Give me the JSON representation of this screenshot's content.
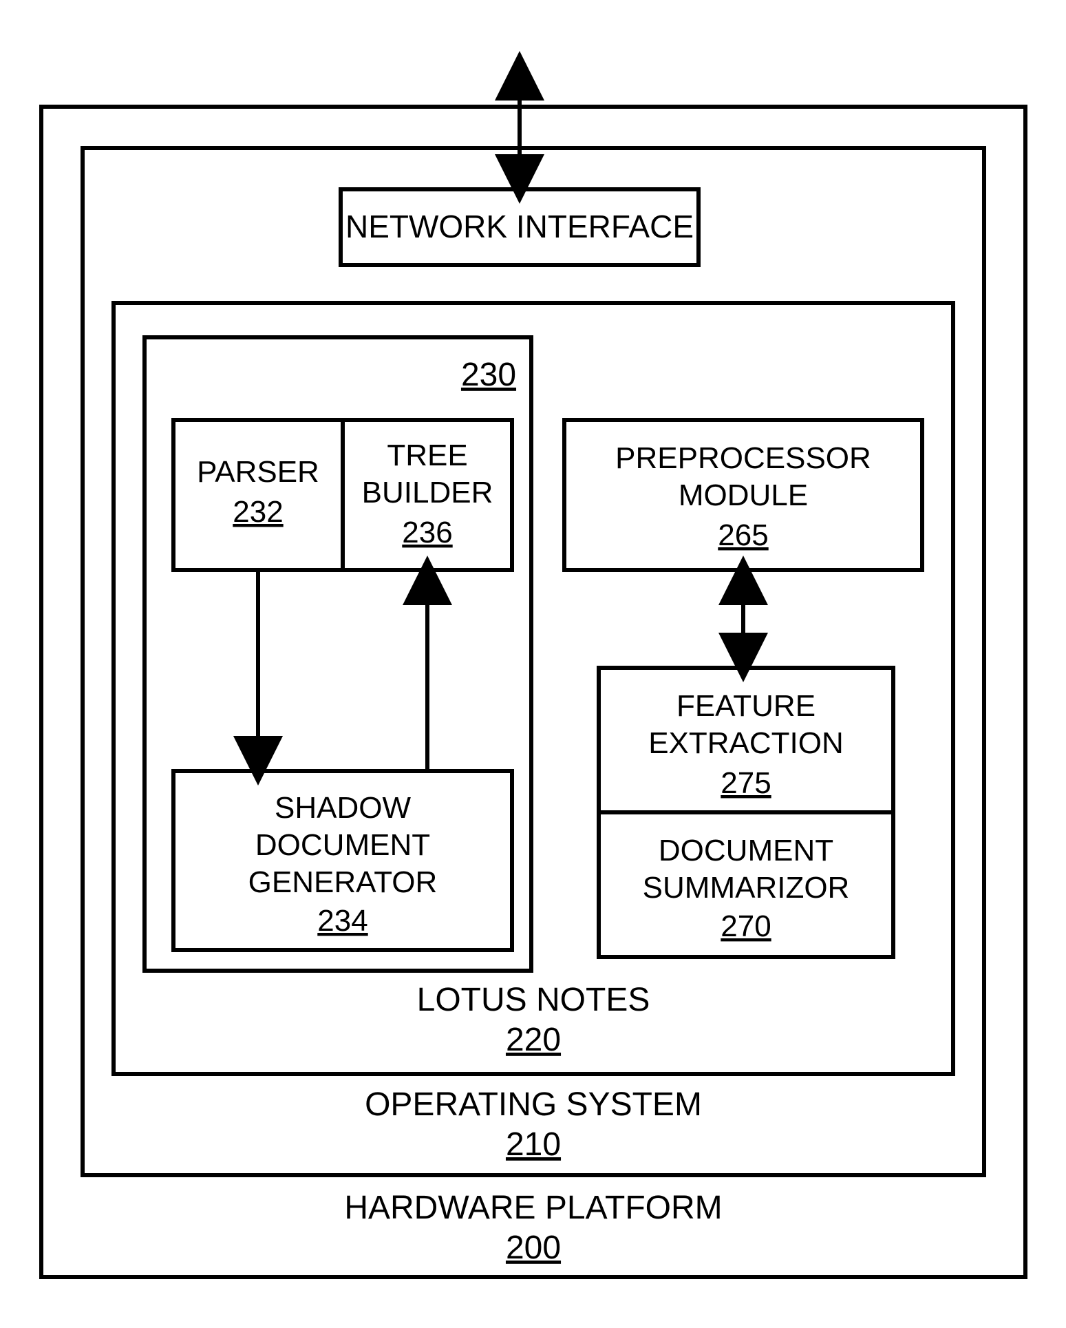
{
  "network_interface": {
    "label": "NETWORK INTERFACE"
  },
  "hardware_platform": {
    "label": "HARDWARE PLATFORM",
    "ref": "200"
  },
  "operating_system": {
    "label": "OPERATING SYSTEM",
    "ref": "210"
  },
  "lotus_notes": {
    "label": "LOTUS NOTES",
    "ref": "220"
  },
  "module_230": {
    "ref": "230"
  },
  "parser": {
    "label": "PARSER",
    "ref": "232"
  },
  "tree_builder": {
    "label1": "TREE",
    "label2": "BUILDER",
    "ref": "236"
  },
  "shadow_doc_gen": {
    "label1": "SHADOW",
    "label2": "DOCUMENT",
    "label3": "GENERATOR",
    "ref": "234"
  },
  "preprocessor": {
    "label1": "PREPROCESSOR",
    "label2": "MODULE",
    "ref": "265"
  },
  "feature_extraction": {
    "label1": "FEATURE",
    "label2": "EXTRACTION",
    "ref": "275"
  },
  "doc_summarizor": {
    "label1": "DOCUMENT",
    "label2": "SUMMARIZOR",
    "ref": "270"
  }
}
